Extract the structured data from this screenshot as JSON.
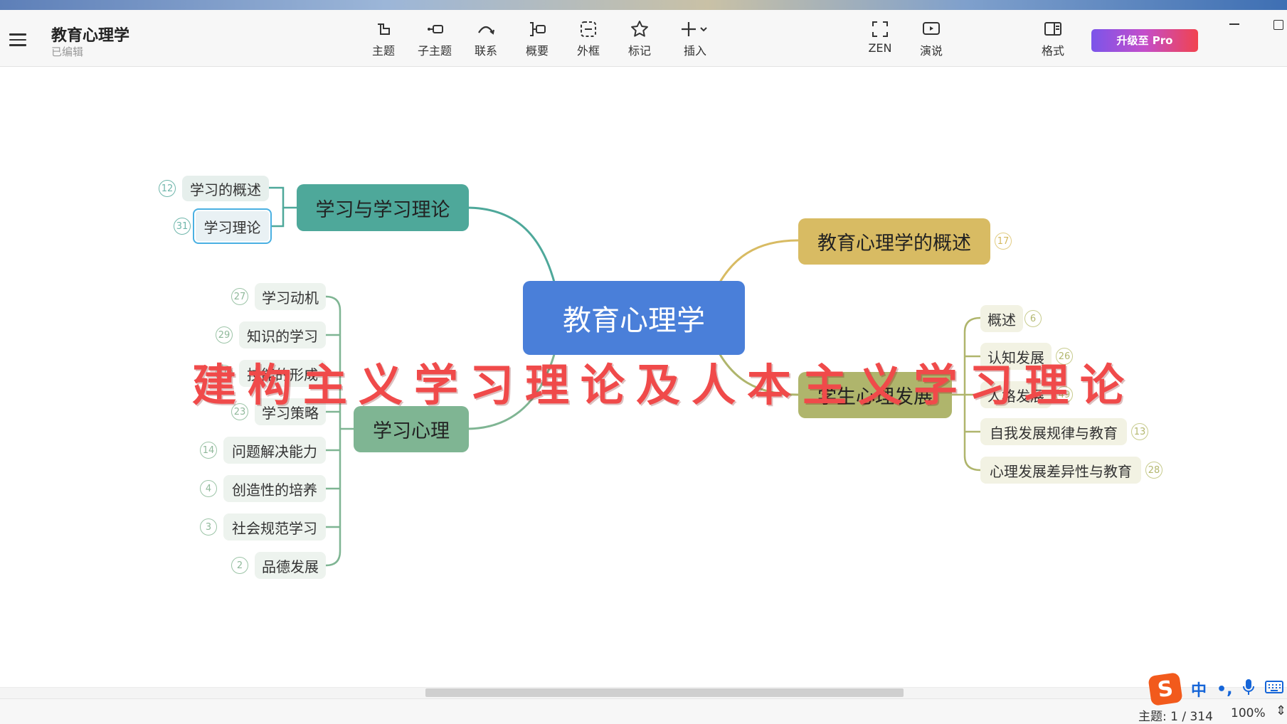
{
  "app": {
    "title": "教育心理学",
    "status": "已编辑"
  },
  "toolbar": {
    "items": [
      {
        "label": "主题",
        "icon": "topic-icon"
      },
      {
        "label": "子主题",
        "icon": "subtopic-icon"
      },
      {
        "label": "联系",
        "icon": "relationship-icon"
      },
      {
        "label": "概要",
        "icon": "summary-icon"
      },
      {
        "label": "外框",
        "icon": "boundary-icon"
      },
      {
        "label": "标记",
        "icon": "star-icon"
      },
      {
        "label": "插入",
        "icon": "plus-icon"
      },
      {
        "label": "ZEN",
        "icon": "zen-fullscreen-icon"
      },
      {
        "label": "演说",
        "icon": "pitch-play-icon"
      },
      {
        "label": "格式",
        "icon": "format-panel-icon"
      }
    ],
    "upgrade_label": "升级至 Pro"
  },
  "mindmap": {
    "root": "教育心理学",
    "branches": {
      "learning_theory": {
        "label": "学习与学习理论",
        "children": [
          {
            "label": "学习的概述",
            "count": "12"
          },
          {
            "label": "学习理论",
            "count": "31"
          }
        ]
      },
      "learning_psychology": {
        "label": "学习心理",
        "children": [
          {
            "label": "学习动机",
            "count": "27"
          },
          {
            "label": "知识的学习",
            "count": "29"
          },
          {
            "label": "技能的形成",
            "count": "10"
          },
          {
            "label": "学习策略",
            "count": "23"
          },
          {
            "label": "问题解决能力",
            "count": "14"
          },
          {
            "label": "创造性的培养",
            "count": "4"
          },
          {
            "label": "社会规范学习",
            "count": "3"
          },
          {
            "label": "品德发展",
            "count": "2"
          }
        ]
      },
      "overview": {
        "label": "教育心理学的概述",
        "count": "17"
      },
      "student_development": {
        "label": "学生心理发展",
        "children": [
          {
            "label": "概述",
            "count": "6"
          },
          {
            "label": "认知发展",
            "count": "26"
          },
          {
            "label": "人格发展",
            "count": "49"
          },
          {
            "label": "自我发展规律与教育",
            "count": "13"
          },
          {
            "label": "心理发展差异性与教育",
            "count": "28"
          }
        ]
      }
    }
  },
  "banner": "建构主义学习理论及人本主义学习理论",
  "statusbar": {
    "topic_count": "主题: 1 / 314",
    "zoom": "100%"
  },
  "ime": {
    "logo": "S",
    "mode": "中",
    "punct": "•,",
    "mic_icon": "microphone-icon",
    "keyboard_icon": "keyboard-icon"
  },
  "colors": {
    "root": "#4a7fd9",
    "learning_theory": "#4ea89a",
    "learning_psychology": "#7fb593",
    "overview": "#d8bb63",
    "student_development": "#afb56c",
    "banner": "#f04a4a",
    "upgrade_gradient": [
      "#7b55ea",
      "#f1434f"
    ]
  }
}
